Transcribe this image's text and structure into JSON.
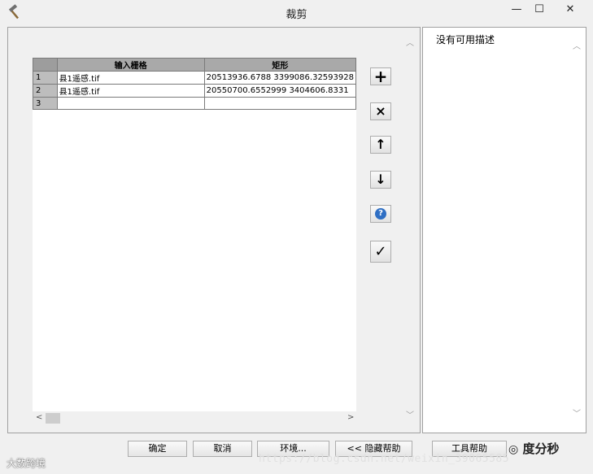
{
  "window": {
    "title": "裁剪",
    "minimize": "—",
    "maximize": "☐",
    "close": "✕"
  },
  "grid": {
    "headers": [
      "",
      "输入栅格",
      "矩形"
    ],
    "rows": [
      {
        "num": "1",
        "raster": "县1遥感.tif",
        "rect": "20513936.6788 3399086.32593928"
      },
      {
        "num": "2",
        "raster": "县1遥感.tif",
        "rect": "20550700.6552999 3404606.8331"
      },
      {
        "num": "3",
        "raster": "",
        "rect": ""
      }
    ]
  },
  "toolbar": {
    "add": "+",
    "remove": "×",
    "up": "↑",
    "down": "↓",
    "info": "?",
    "check": "✓"
  },
  "help_panel": {
    "text": "没有可用描述"
  },
  "buttons": {
    "ok": "确定",
    "cancel": "取消",
    "env": "环境...",
    "hide_help": "<< 隐藏帮助",
    "tool_help": "工具帮助"
  },
  "watermarks": {
    "left": "大数跨境",
    "url": "https://blog.csdn.net/weixin_39065585",
    "logo": "度分秒"
  }
}
